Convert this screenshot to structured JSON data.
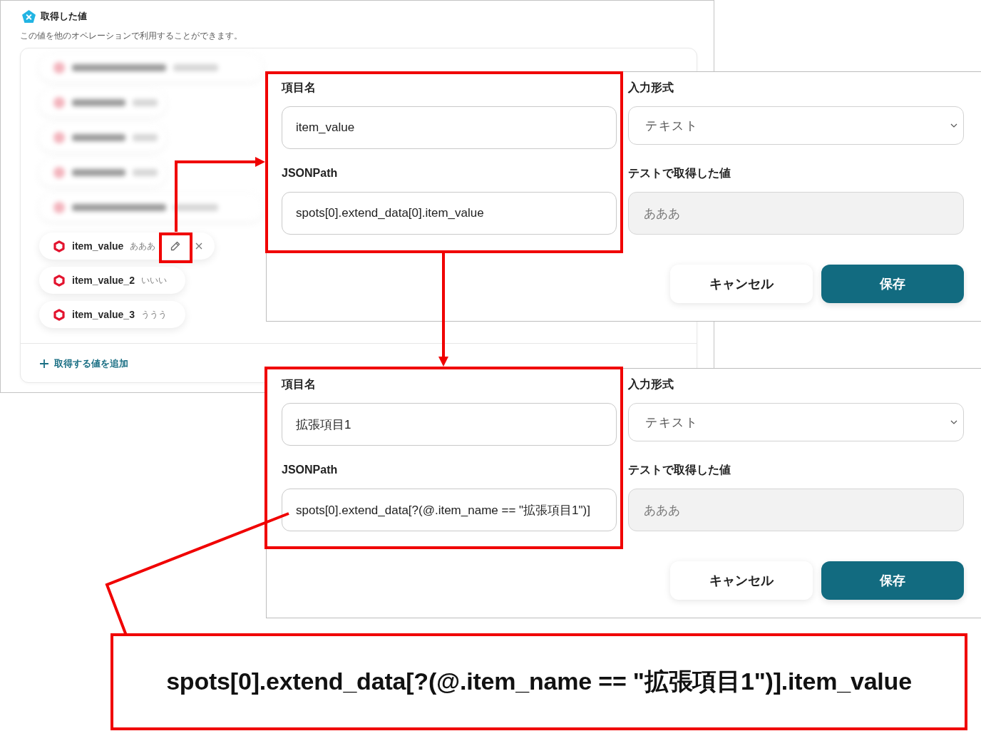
{
  "values_panel": {
    "title": "取得した値",
    "description": "この値を他のオペレーションで利用することができます。",
    "items": [
      {
        "name": "item_value",
        "value": "あああ",
        "selected": true
      },
      {
        "name": "item_value_2",
        "value": "いいい",
        "selected": false
      },
      {
        "name": "item_value_3",
        "value": "ううう",
        "selected": false
      }
    ],
    "add_button": "取得する値を追加"
  },
  "edit_forms": [
    {
      "item_name": {
        "label": "項目名",
        "value": "item_value"
      },
      "jsonpath": {
        "label": "JSONPath",
        "value": "spots[0].extend_data[0].item_value"
      },
      "input_type": {
        "label": "入力形式",
        "value": "テキスト"
      },
      "test_value": {
        "label": "テストで取得した値",
        "value": "あああ",
        "disabled": true
      },
      "buttons": [
        {
          "label": "キャンセル",
          "kind": "secondary"
        },
        {
          "label": "保存",
          "kind": "primary"
        }
      ]
    },
    {
      "item_name": {
        "label": "項目名",
        "value": "拡張項目1"
      },
      "jsonpath": {
        "label": "JSONPath",
        "value": "spots[0].extend_data[?(@.item_name == \"拡張項目1\")]"
      },
      "input_type": {
        "label": "入力形式",
        "value": "テキスト"
      },
      "test_value": {
        "label": "テストで取得した値",
        "value": "あああ",
        "disabled": true
      },
      "buttons": [
        {
          "label": "キャンセル",
          "kind": "secondary"
        },
        {
          "label": "保存",
          "kind": "primary"
        }
      ]
    }
  ],
  "callout": {
    "text": "spots[0].extend_data[?(@.item_name == \"拡張項目1\")].item_value"
  }
}
